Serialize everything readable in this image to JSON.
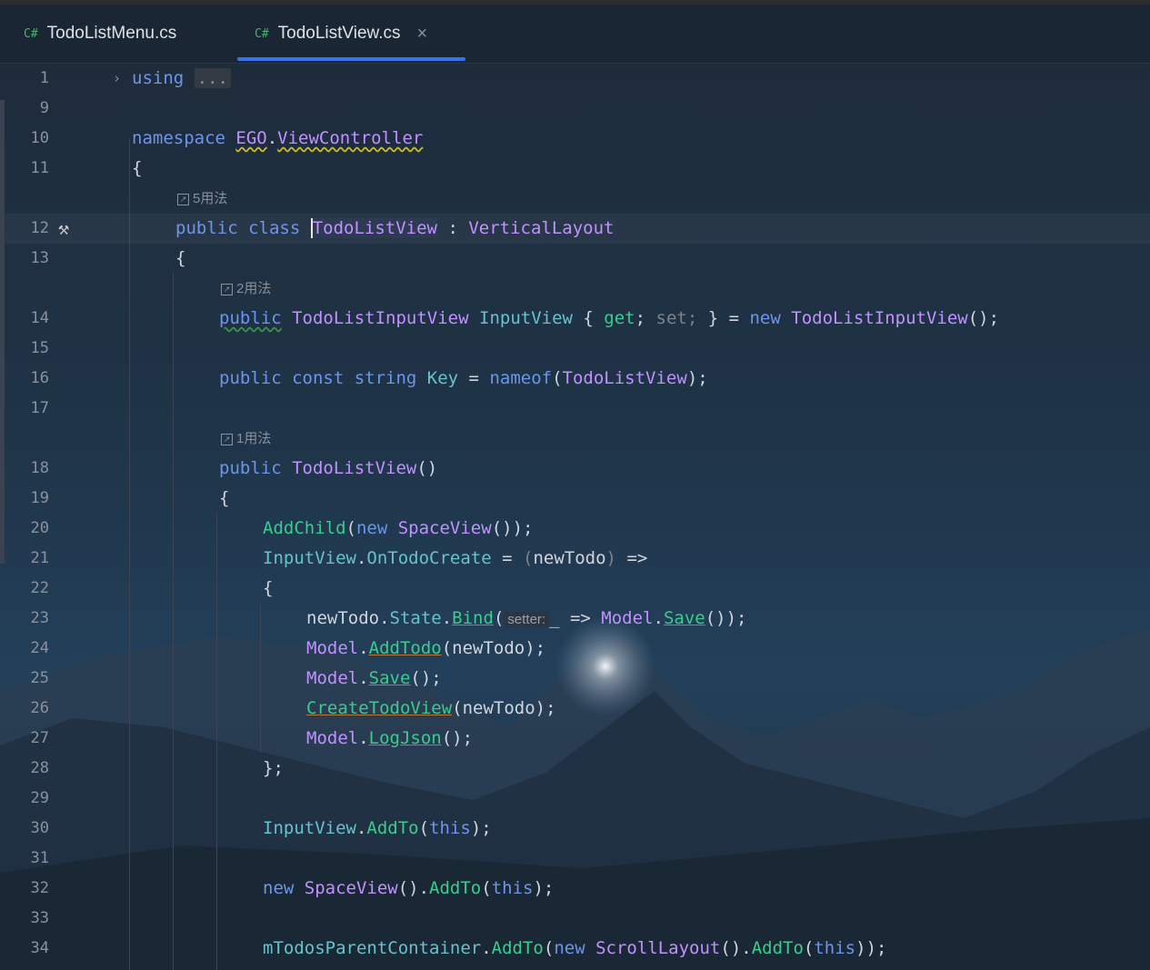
{
  "tabs": [
    {
      "lang": "C#",
      "name": "TodoListMenu.cs",
      "active": false
    },
    {
      "lang": "C#",
      "name": "TodoListView.cs",
      "active": true,
      "close": "×"
    }
  ],
  "editor": {
    "fold_placeholder": "...",
    "param_hint": "setter:",
    "usages": [
      "5用法",
      "2用法",
      "1用法"
    ],
    "gutter_icon": "hammer-icon",
    "lines": {
      "l1": {
        "num": "1",
        "t": [
          [
            "kw",
            "using"
          ]
        ]
      },
      "l9": {
        "num": "9"
      },
      "l10": {
        "num": "10",
        "t": [
          [
            "kw",
            "namespace "
          ],
          [
            "ty",
            "EGO"
          ],
          [
            "pl",
            "."
          ],
          [
            "ty",
            "ViewController"
          ]
        ]
      },
      "l11": {
        "num": "11",
        "t": [
          [
            "pl",
            "{"
          ]
        ]
      },
      "l12": {
        "num": "12",
        "t": [
          [
            "kw",
            "public class "
          ],
          [
            "ty",
            "TodoListView"
          ],
          [
            "pl",
            " : "
          ],
          [
            "ty",
            "VerticalLayout"
          ]
        ]
      },
      "l13": {
        "num": "13",
        "t": [
          [
            "pl",
            "{"
          ]
        ]
      },
      "l14": {
        "num": "14",
        "t": [
          [
            "kw",
            "public"
          ],
          [
            "pl",
            " "
          ],
          [
            "ty",
            "TodoListInputView"
          ],
          [
            "pl",
            " "
          ],
          [
            "pr",
            "InputView"
          ],
          [
            "pl",
            " { "
          ],
          [
            "me",
            "get"
          ],
          [
            "pl",
            "; "
          ],
          [
            "dim",
            "set;"
          ],
          [
            "pl",
            " } = "
          ],
          [
            "kw",
            "new "
          ],
          [
            "ty",
            "TodoListInputView"
          ],
          [
            "pl",
            "();"
          ]
        ]
      },
      "l15": {
        "num": "15"
      },
      "l16": {
        "num": "16",
        "t": [
          [
            "kw",
            "public const string "
          ],
          [
            "pr",
            "Key"
          ],
          [
            "pl",
            " = "
          ],
          [
            "kw",
            "nameof"
          ],
          [
            "pl",
            "("
          ],
          [
            "ty",
            "TodoListView"
          ],
          [
            "pl",
            ");"
          ]
        ]
      },
      "l17": {
        "num": "17"
      },
      "l18": {
        "num": "18",
        "t": [
          [
            "kw",
            "public "
          ],
          [
            "ty",
            "TodoListView"
          ],
          [
            "pl",
            "()"
          ]
        ]
      },
      "l19": {
        "num": "19",
        "t": [
          [
            "pl",
            "{"
          ]
        ]
      },
      "l20": {
        "num": "20",
        "t": [
          [
            "me",
            "AddChild"
          ],
          [
            "pl",
            "("
          ],
          [
            "kw",
            "new "
          ],
          [
            "ty",
            "SpaceView"
          ],
          [
            "pl",
            "());"
          ]
        ]
      },
      "l21": {
        "num": "21",
        "t": [
          [
            "pr",
            "InputView"
          ],
          [
            "pl",
            "."
          ],
          [
            "pr",
            "OnTodoCreate"
          ],
          [
            "pl",
            " = "
          ],
          [
            "dim",
            "("
          ],
          [
            "pl",
            "newTodo"
          ],
          [
            "dim",
            ")"
          ],
          [
            "pl",
            " =>"
          ]
        ]
      },
      "l22": {
        "num": "22",
        "t": [
          [
            "pl",
            "{"
          ]
        ]
      },
      "l23": {
        "num": "23",
        "t": [
          [
            "pl",
            "newTodo."
          ],
          [
            "pr",
            "State"
          ],
          [
            "pl",
            "."
          ],
          [
            "me",
            "Bind"
          ],
          [
            "pl",
            "("
          ]
        ]
      },
      "l23b": {
        "t": [
          [
            "pl",
            "_ => "
          ],
          [
            "ty",
            "Model"
          ],
          [
            "pl",
            "."
          ],
          [
            "me",
            "Save"
          ],
          [
            "pl",
            "());"
          ]
        ]
      },
      "l24": {
        "num": "24",
        "t": [
          [
            "ty",
            "Model"
          ],
          [
            "pl",
            "."
          ],
          [
            "me",
            "AddTodo"
          ],
          [
            "pl",
            "(newTodo);"
          ]
        ]
      },
      "l25": {
        "num": "25",
        "t": [
          [
            "ty",
            "Model"
          ],
          [
            "pl",
            "."
          ],
          [
            "me",
            "Save"
          ],
          [
            "pl",
            "();"
          ]
        ]
      },
      "l26": {
        "num": "26",
        "t": [
          [
            "me",
            "CreateTodoView"
          ],
          [
            "pl",
            "(newTodo);"
          ]
        ]
      },
      "l27": {
        "num": "27",
        "t": [
          [
            "ty",
            "Model"
          ],
          [
            "pl",
            "."
          ],
          [
            "me",
            "LogJson"
          ],
          [
            "pl",
            "();"
          ]
        ]
      },
      "l28": {
        "num": "28",
        "t": [
          [
            "pl",
            "};"
          ]
        ]
      },
      "l29": {
        "num": "29"
      },
      "l30": {
        "num": "30",
        "t": [
          [
            "pr",
            "InputView"
          ],
          [
            "pl",
            "."
          ],
          [
            "me",
            "AddTo"
          ],
          [
            "pl",
            "("
          ],
          [
            "kw",
            "this"
          ],
          [
            "pl",
            ");"
          ]
        ]
      },
      "l31": {
        "num": "31"
      },
      "l32": {
        "num": "32",
        "t": [
          [
            "kw",
            "new "
          ],
          [
            "ty",
            "SpaceView"
          ],
          [
            "pl",
            "()."
          ],
          [
            "me",
            "AddTo"
          ],
          [
            "pl",
            "("
          ],
          [
            "kw",
            "this"
          ],
          [
            "pl",
            ");"
          ]
        ]
      },
      "l33": {
        "num": "33"
      },
      "l34": {
        "num": "34",
        "t": [
          [
            "pr",
            "mTodosParentContainer"
          ],
          [
            "pl",
            "."
          ],
          [
            "me",
            "AddTo"
          ],
          [
            "pl",
            "("
          ],
          [
            "kw",
            "new "
          ],
          [
            "ty",
            "ScrollLayout"
          ],
          [
            "pl",
            "()."
          ],
          [
            "me",
            "AddTo"
          ],
          [
            "pl",
            "("
          ],
          [
            "kw",
            "this"
          ],
          [
            "pl",
            "));"
          ]
        ]
      }
    }
  },
  "colors": {
    "keyword": "#6c95eb",
    "type": "#c191ff",
    "method": "#39cc8f",
    "property": "#66c3cc",
    "accent": "#3574f0"
  }
}
